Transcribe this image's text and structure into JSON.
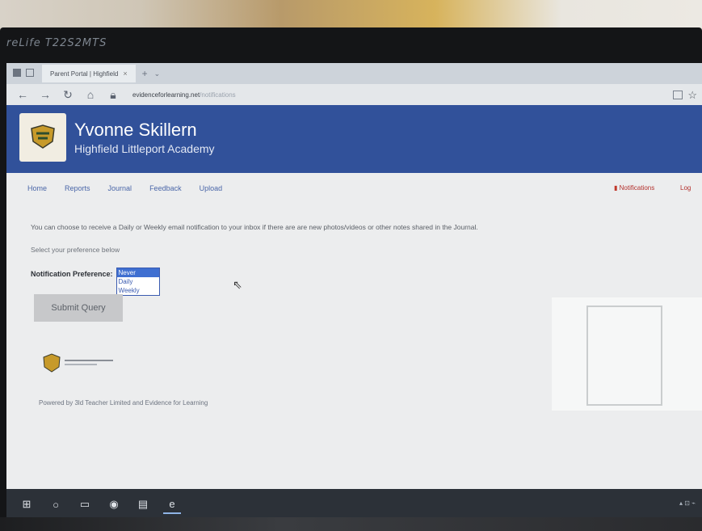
{
  "monitor": {
    "model_label": "reLife T22S2MTS"
  },
  "browser": {
    "tab_title": "Parent Portal | Highfield",
    "tab_close": "×",
    "new_tab": "+",
    "tab_menu": "⌄",
    "url_main": "evidenceforlearning.net",
    "url_path": "/notifications"
  },
  "banner": {
    "name": "Yvonne Skillern",
    "school": "Highfield Littleport Academy"
  },
  "nav": {
    "items": [
      "Home",
      "Reports",
      "Journal",
      "Feedback",
      "Upload"
    ],
    "notifications": "Notifications",
    "logout": "Log"
  },
  "content": {
    "intro": "You can choose to receive a Daily or Weekly email notification to your inbox if there are are new photos/videos or other notes shared in the Journal.",
    "select_prompt": "Select your preference below",
    "pref_label": "Notification Preference:",
    "options": [
      "Never",
      "Daily",
      "Weekly"
    ],
    "selected_option": "Never",
    "submit_label": "Submit Query",
    "powered_by": "Powered by 3ld Teacher Limited and Evidence for Learning"
  },
  "colors": {
    "banner": "#31519a",
    "link": "#4a66a8",
    "alert": "#b3302c",
    "selected": "#3f6fd1"
  },
  "icons": [
    "back-icon",
    "forward-icon",
    "refresh-icon",
    "home-icon",
    "lock-icon",
    "star-icon",
    "bell-icon",
    "windows-start-icon",
    "search-icon",
    "task-view-icon",
    "chrome-icon",
    "store-icon",
    "edge-icon"
  ]
}
